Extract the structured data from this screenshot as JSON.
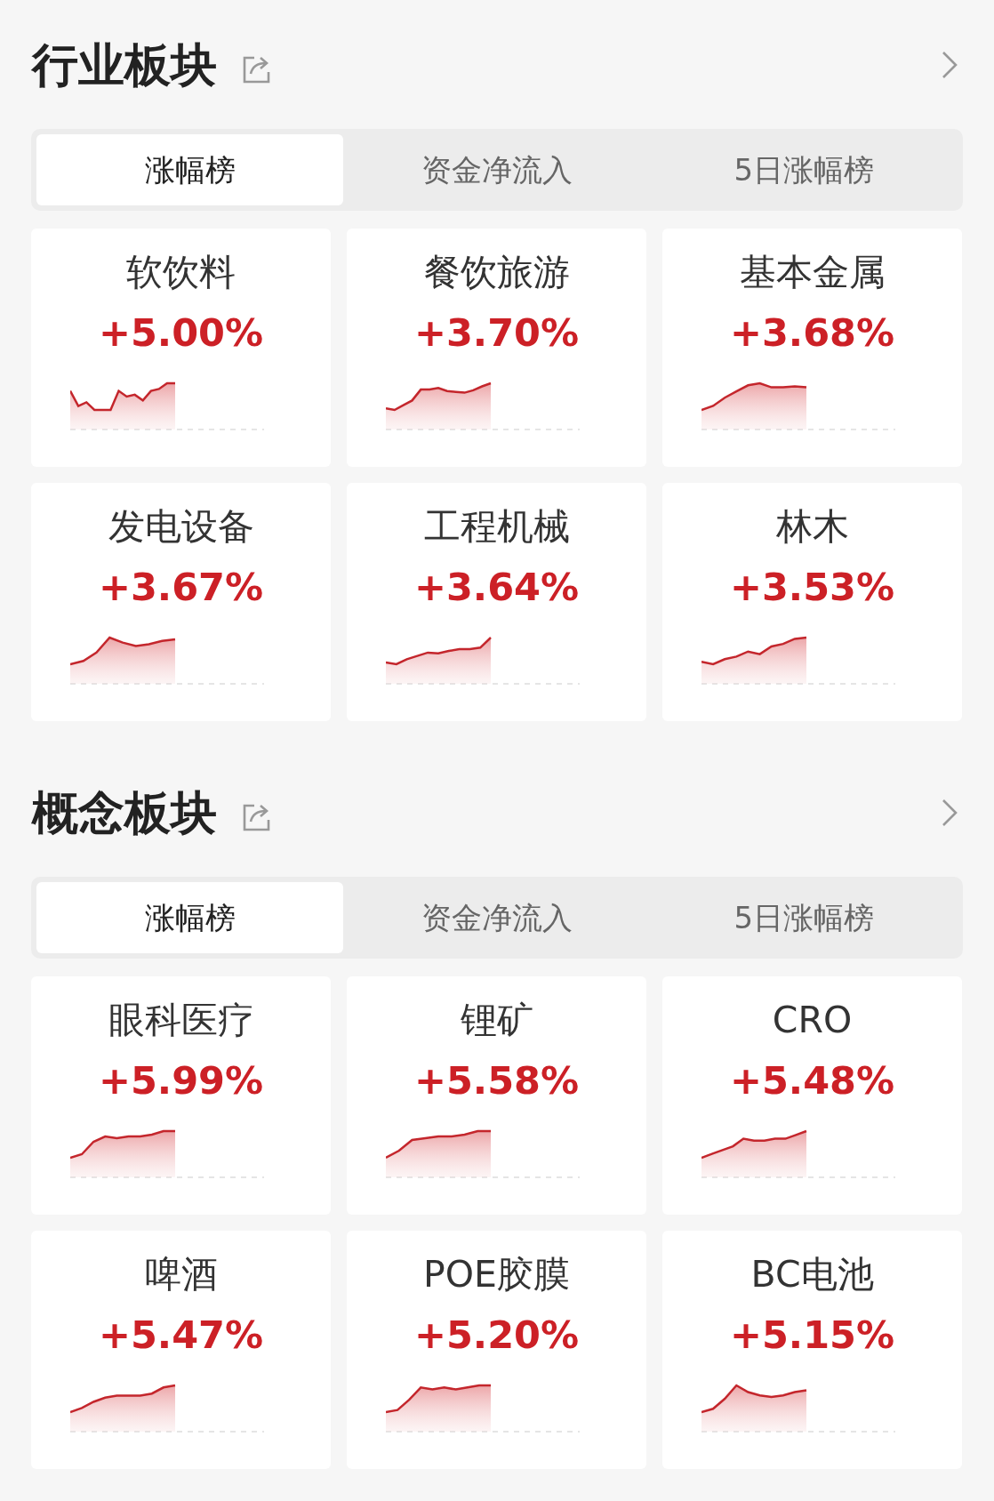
{
  "sections": [
    {
      "title": "行业板块",
      "tabs": [
        {
          "label": "涨幅榜",
          "selected": true
        },
        {
          "label": "资金净流入",
          "selected": false
        },
        {
          "label": "5日涨幅榜",
          "selected": false
        }
      ],
      "cards": [
        {
          "name": "软饮料",
          "change": "+5.00%"
        },
        {
          "name": "餐饮旅游",
          "change": "+3.70%"
        },
        {
          "name": "基本金属",
          "change": "+3.68%"
        },
        {
          "name": "发电设备",
          "change": "+3.67%"
        },
        {
          "name": "工程机械",
          "change": "+3.64%"
        },
        {
          "name": "林木",
          "change": "+3.53%"
        }
      ]
    },
    {
      "title": "概念板块",
      "tabs": [
        {
          "label": "涨幅榜",
          "selected": true
        },
        {
          "label": "资金净流入",
          "selected": false
        },
        {
          "label": "5日涨幅榜",
          "selected": false
        }
      ],
      "cards": [
        {
          "name": "眼科医疗",
          "change": "+5.99%"
        },
        {
          "name": "锂矿",
          "change": "+5.58%"
        },
        {
          "name": "CRO",
          "change": "+5.48%"
        },
        {
          "name": "啤酒",
          "change": "+5.47%"
        },
        {
          "name": "POE胶膜",
          "change": "+5.20%"
        },
        {
          "name": "BC电池",
          "change": "+5.15%"
        }
      ]
    }
  ]
}
